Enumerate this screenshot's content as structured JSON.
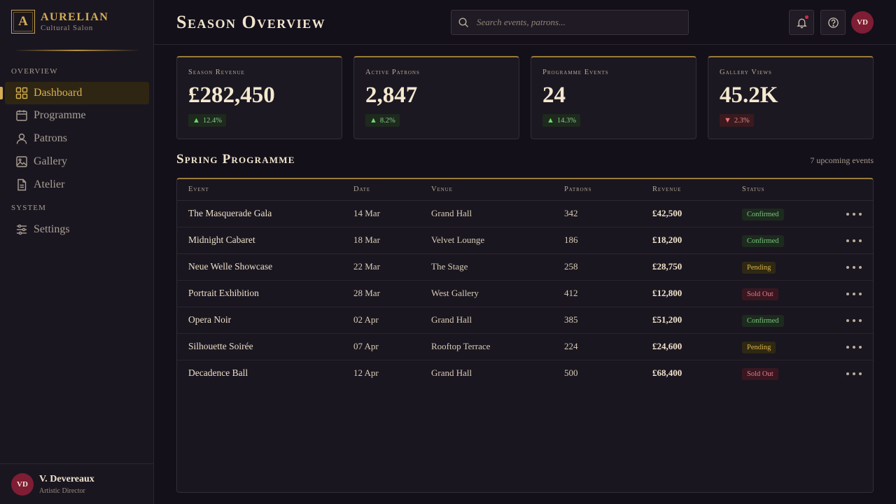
{
  "brand": {
    "mark": "A",
    "name": "AURELIAN",
    "subtitle": "Cultural Salon"
  },
  "sidebar": {
    "sections": [
      "OVERVIEW",
      "SYSTEM"
    ],
    "items": [
      {
        "label": "Dashboard",
        "icon": "grid-icon",
        "active": true
      },
      {
        "label": "Programme",
        "icon": "calendar-icon",
        "active": false
      },
      {
        "label": "Patrons",
        "icon": "user-icon",
        "active": false
      },
      {
        "label": "Gallery",
        "icon": "image-icon",
        "active": false
      },
      {
        "label": "Atelier",
        "icon": "document-icon",
        "active": false
      },
      {
        "label": "Settings",
        "icon": "sliders-icon",
        "active": false
      }
    ]
  },
  "user": {
    "initials": "VD",
    "name": "V. Devereaux",
    "role": "Artistic Director"
  },
  "header": {
    "title": "Season Overview",
    "search_placeholder": "Search events, patrons...",
    "notifications_icon": "bell-icon",
    "help_icon": "help-circle-icon",
    "avatar_initials": "VD"
  },
  "stats": [
    {
      "label": "Season Revenue",
      "value": "£282,450",
      "delta": "12.4%",
      "trend": "up"
    },
    {
      "label": "Active Patrons",
      "value": "2,847",
      "delta": "8.2%",
      "trend": "up"
    },
    {
      "label": "Programme Events",
      "value": "24",
      "delta": "14.3%",
      "trend": "up"
    },
    {
      "label": "Gallery Views",
      "value": "45.2K",
      "delta": "2.3%",
      "trend": "down"
    }
  ],
  "programme": {
    "title": "Spring Programme",
    "meta": "7 upcoming events",
    "columns": [
      "Event",
      "Date",
      "Venue",
      "Patrons",
      "Revenue",
      "Status"
    ],
    "rows": [
      {
        "event": "The Masquerade Gala",
        "date": "14 Mar",
        "venue": "Grand Hall",
        "patrons": "342",
        "revenue": "£42,500",
        "status": "Confirmed"
      },
      {
        "event": "Midnight Cabaret",
        "date": "18 Mar",
        "venue": "Velvet Lounge",
        "patrons": "186",
        "revenue": "£18,200",
        "status": "Confirmed"
      },
      {
        "event": "Neue Welle Showcase",
        "date": "22 Mar",
        "venue": "The Stage",
        "patrons": "258",
        "revenue": "£28,750",
        "status": "Pending"
      },
      {
        "event": "Portrait Exhibition",
        "date": "28 Mar",
        "venue": "West Gallery",
        "patrons": "412",
        "revenue": "£12,800",
        "status": "Sold Out"
      },
      {
        "event": "Opera Noir",
        "date": "02 Apr",
        "venue": "Grand Hall",
        "patrons": "385",
        "revenue": "£51,200",
        "status": "Confirmed"
      },
      {
        "event": "Silhouette Soirée",
        "date": "07 Apr",
        "venue": "Rooftop Terrace",
        "patrons": "224",
        "revenue": "£24,600",
        "status": "Pending"
      },
      {
        "event": "Decadence Ball",
        "date": "12 Apr",
        "venue": "Grand Hall",
        "patrons": "500",
        "revenue": "£68,400",
        "status": "Sold Out"
      }
    ]
  },
  "colors": {
    "background": "#13101a",
    "sidebar": "#1a1620",
    "gold_accent": "#d4ad55",
    "avatar": "#7f1d35",
    "confirmed": "#79c57d",
    "pending": "#d8b44a",
    "sold_out": "#e07a8a"
  }
}
